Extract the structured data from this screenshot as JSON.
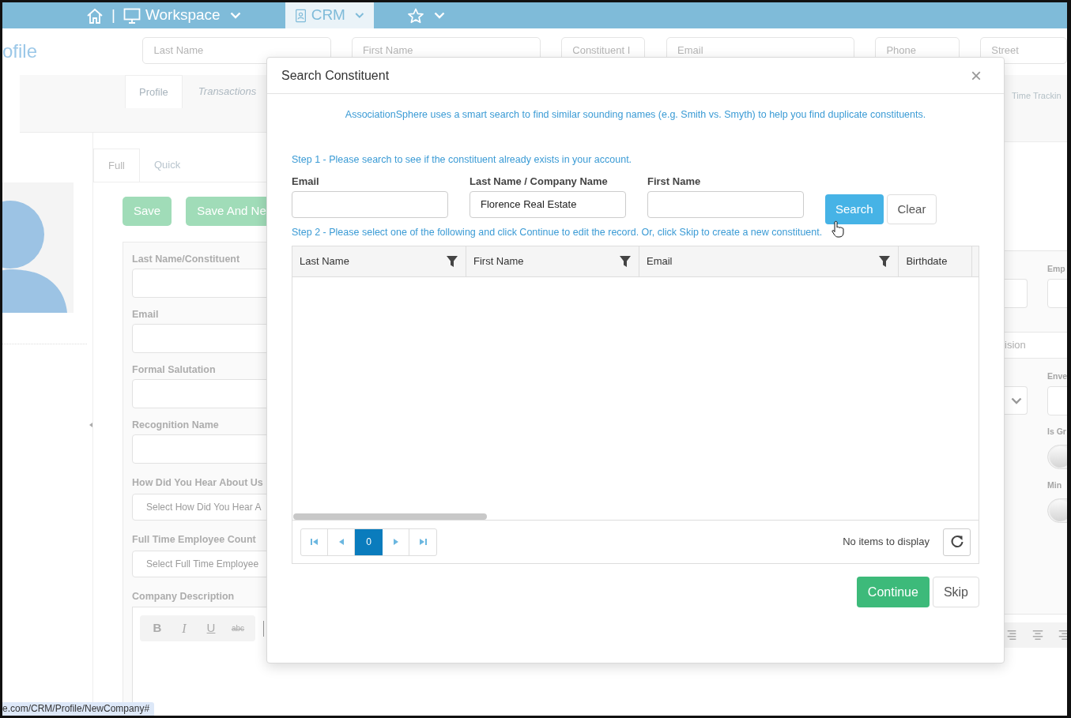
{
  "nav": {
    "separator": "|",
    "tabs": [
      {
        "kind": "home",
        "selected": false
      },
      {
        "kind": "monitor",
        "label": "Workspace",
        "selected": false
      },
      {
        "kind": "contact",
        "label": "CRM",
        "selected": true
      },
      {
        "kind": "star",
        "selected": false
      }
    ]
  },
  "page_title": "ofile",
  "filters": [
    "Last Name",
    "First Name",
    "Constituent I",
    "Email",
    "Phone",
    "Street"
  ],
  "profile_tabs": [
    {
      "label": "Profile",
      "selected": true
    },
    {
      "label": "Transactions",
      "selected": false
    }
  ],
  "form_tabs": [
    {
      "label": "Full",
      "selected": true
    },
    {
      "label": "Quick",
      "selected": false
    }
  ],
  "form_buttons": [
    "Save",
    "Save And Ne"
  ],
  "form_fields": [
    {
      "label": "Last Name/Constituent",
      "kind": "text"
    },
    {
      "label": "Email",
      "kind": "text"
    },
    {
      "label": "Formal Salutation",
      "kind": "text"
    },
    {
      "label": "Recognition Name",
      "kind": "text"
    },
    {
      "label": "How Did You Hear About Us",
      "kind": "select",
      "placeholder": "Select How Did You Hear A"
    },
    {
      "label": "Full Time Employee Count",
      "kind": "select",
      "placeholder": "Select Full Time Employee"
    },
    {
      "label": "Company Description",
      "kind": "editor"
    }
  ],
  "editor_toolbar": [
    "B",
    "I",
    "U",
    "abc"
  ],
  "status_url": "e.com/CRM/Profile/NewCompany#",
  "right_panel": {
    "tab": "Time Trackin",
    "section": "ision",
    "fields": [
      {
        "label": "Emp",
        "kind": "text"
      },
      {
        "label": "Enve",
        "kind": "text"
      },
      {
        "label": "Is Gr",
        "kind": "toggle",
        "on": false
      },
      {
        "label": "Min",
        "kind": "toggle",
        "on": false
      }
    ]
  },
  "modal": {
    "title": "Search Constituent",
    "close": "×",
    "info": "AssociationSphere uses a smart search to find similar sounding names (e.g. Smith vs. Smyth) to help you find duplicate constituents.",
    "step1": "Step 1 - Please search to see if the constituent already exists in your account.",
    "fields": [
      {
        "label": "Email"
      },
      {
        "label": "Last Name / Company Name",
        "value": "Florence Real Estate"
      },
      {
        "label": "First Name"
      }
    ],
    "search_button": "Search",
    "clear_button": "Clear",
    "step2": "Step 2 - Please select one of the following and click Continue to edit the record. Or, click Skip to create a new constituent.",
    "table": {
      "columns": [
        {
          "label": "Last Name",
          "filter": true
        },
        {
          "label": "First Name",
          "filter": true
        },
        {
          "label": "Email",
          "filter": true
        },
        {
          "label": "Birthdate",
          "filter": false
        }
      ]
    },
    "pager": {
      "pages": [
        {
          "label": "0",
          "selected": true
        }
      ],
      "status": "No items to display"
    },
    "continue_button": "Continue",
    "skip_button": "Skip"
  }
}
